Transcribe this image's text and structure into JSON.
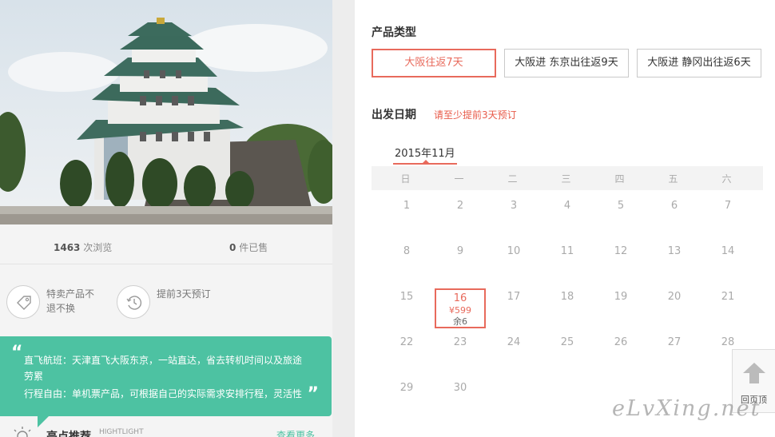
{
  "product": {
    "stats": {
      "views_count": "1463",
      "views_label": "次浏览",
      "sold_count": "0",
      "sold_label": "件已售"
    },
    "features": [
      {
        "icon": "tag-icon",
        "text": "特卖产品不退不换"
      },
      {
        "icon": "clock-icon",
        "text": "提前3天预订"
      }
    ],
    "quote": {
      "line1": "直飞航班：天津直飞大阪东京，一站直达，省去转机时间以及旅途劳累",
      "line2": "行程自由：单机票产品，可根据自己的实际需求安排行程，灵活性"
    },
    "highlight": {
      "title": "亮点推荐",
      "subtitle": "HIGHTLIGHT",
      "more": "查看更多"
    },
    "accent_color": "#4dc2a2"
  },
  "booking": {
    "type_title": "产品类型",
    "types": [
      {
        "label": "大阪往返7天",
        "selected": true
      },
      {
        "label": "大阪进 东京出往返9天",
        "selected": false
      },
      {
        "label": "大阪进 静冈出往返6天",
        "selected": false
      }
    ],
    "date_title": "出发日期",
    "date_hint": "请至少提前3天预订",
    "month": "2015年11月",
    "weekdays": [
      "日",
      "一",
      "二",
      "三",
      "四",
      "五",
      "六"
    ],
    "days": [
      "1",
      "2",
      "3",
      "4",
      "5",
      "6",
      "7",
      "8",
      "9",
      "10",
      "11",
      "12",
      "13",
      "14",
      "15",
      "16",
      "17",
      "18",
      "19",
      "20",
      "21",
      "22",
      "23",
      "24",
      "25",
      "26",
      "27",
      "28",
      "29",
      "30"
    ],
    "available": {
      "day": "16",
      "price": "¥599",
      "stock": "余6"
    },
    "accent_color": "#e86a5c"
  },
  "back_to_top": "回页顶",
  "watermark": "eLvXing.net"
}
